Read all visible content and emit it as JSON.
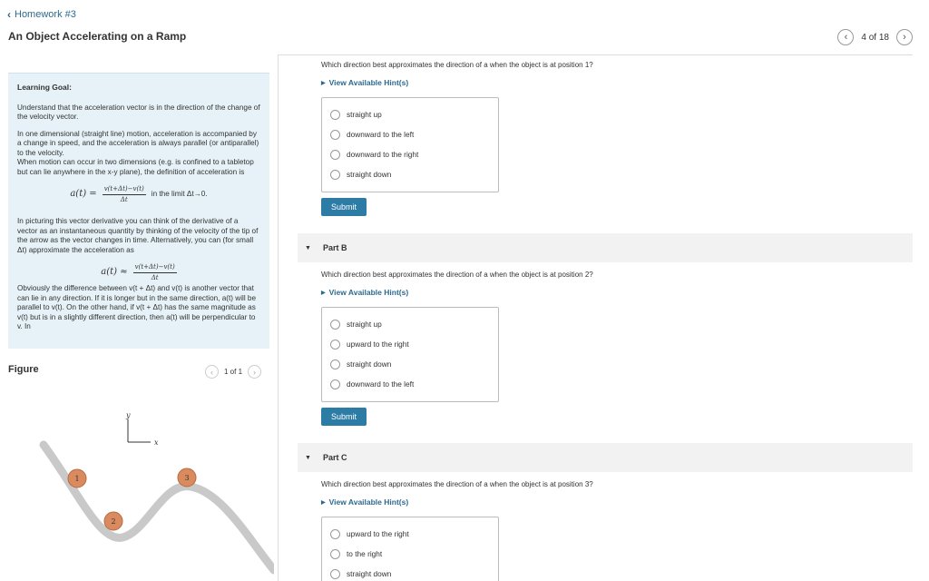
{
  "header": {
    "back_label": "Homework #3",
    "title": "An Object Accelerating on a Ramp",
    "pager_text": "4 of 18"
  },
  "learning_goal": {
    "heading": "Learning Goal:",
    "p1": "Understand that the acceleration vector is in the direction of the change of the velocity vector.",
    "p2": "In one dimensional (straight line) motion, acceleration is accompanied by a change in speed, and the acceleration is always parallel (or antiparallel) to the velocity.",
    "p3": "When motion can occur in two dimensions (e.g. is confined to a tabletop but can lie anywhere in the x-y plane), the definition of acceleration is",
    "formula1_lhs": "a(t) =",
    "formula1_num": "v(t+Δt)−v(t)",
    "formula1_den": "Δt",
    "formula1_tail": "in the limit Δt→0.",
    "p4": "In picturing this vector derivative you can think of the derivative of a vector as an instantaneous quantity by thinking of the velocity of the tip of the arrow as the vector changes in time. Alternatively, you can (for small Δt) approximate the acceleration as",
    "formula2_lhs": "a(t) ≈",
    "formula2_num": "v(t+Δt)−v(t)",
    "formula2_den": "Δt",
    "p5": "Obviously the difference between v(t + Δt) and v(t) is another vector that can lie in any direction. If it is longer but in the same direction, a(t) will be parallel to v(t). On the other hand, if v(t + Δt) has the same magnitude as v(t) but is in a slightly different direction, then a(t) will be perpendicular to v. In"
  },
  "figure": {
    "label": "Figure",
    "pager_text": "1 of 1",
    "axis_y": "y",
    "axis_x": "x",
    "ball_labels": [
      "1",
      "2",
      "3"
    ]
  },
  "part_a": {
    "question": "Which direction best approximates the direction of a when the object is at position 1?",
    "hint": "View Available Hint(s)",
    "options": [
      "straight up",
      "downward to the left",
      "downward to the right",
      "straight down"
    ],
    "submit": "Submit"
  },
  "part_b": {
    "header": "Part B",
    "question": "Which direction best approximates the direction of a when the object is at position 2?",
    "hint": "View Available Hint(s)",
    "options": [
      "straight up",
      "upward to the right",
      "straight down",
      "downward to the left"
    ],
    "submit": "Submit"
  },
  "part_c": {
    "header": "Part C",
    "question": "Which direction best approximates the direction of a when the object is at position 3?",
    "hint": "View Available Hint(s)",
    "options": [
      "upward to the right",
      "to the right",
      "straight down"
    ]
  },
  "icons": {
    "back": "chevron-left-icon",
    "prev": "chevron-left-icon",
    "next": "chevron-right-icon",
    "collapse": "triangle-down-icon",
    "hint": "triangle-right-icon"
  },
  "colors": {
    "link": "#2c6a8e",
    "button": "#2d7ca6",
    "goal_bg": "#e6f2f7",
    "ramp": "#c9c9c9",
    "ball": "#d98b5f"
  }
}
